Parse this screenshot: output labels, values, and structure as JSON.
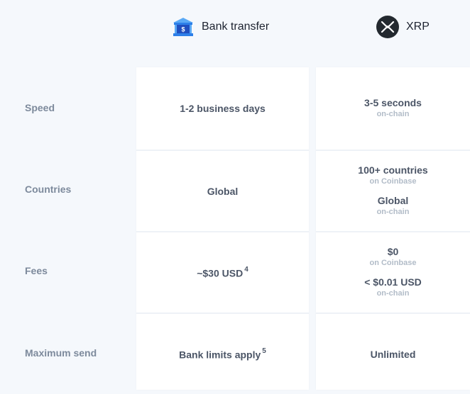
{
  "columns": {
    "bank": {
      "label": "Bank transfer",
      "icon": "bank-building-icon"
    },
    "xrp": {
      "label": "XRP",
      "icon": "xrp-logo-icon"
    }
  },
  "rows": {
    "speed": {
      "label": "Speed",
      "bank": "1-2 business days",
      "xrp_value": "3-5 seconds",
      "xrp_sub": "on-chain"
    },
    "countries": {
      "label": "Countries",
      "bank": "Global",
      "xrp_value_1": "100+ countries",
      "xrp_sub_1": "on Coinbase",
      "xrp_value_2": "Global",
      "xrp_sub_2": "on-chain"
    },
    "fees": {
      "label": "Fees",
      "bank": "~$30 USD",
      "bank_sup": "4",
      "xrp_value_1": "$0",
      "xrp_sub_1": "on Coinbase",
      "xrp_value_2": "< $0.01 USD",
      "xrp_sub_2": "on-chain"
    },
    "max_send": {
      "label": "Maximum send",
      "bank": "Bank limits apply",
      "bank_sup": "5",
      "xrp": "Unlimited"
    }
  },
  "colors": {
    "page_bg": "#f5f8fc",
    "card_bg": "#ffffff",
    "bank_icon_blue": "#1f6fe0",
    "xrp_icon_bg": "#23292f"
  }
}
